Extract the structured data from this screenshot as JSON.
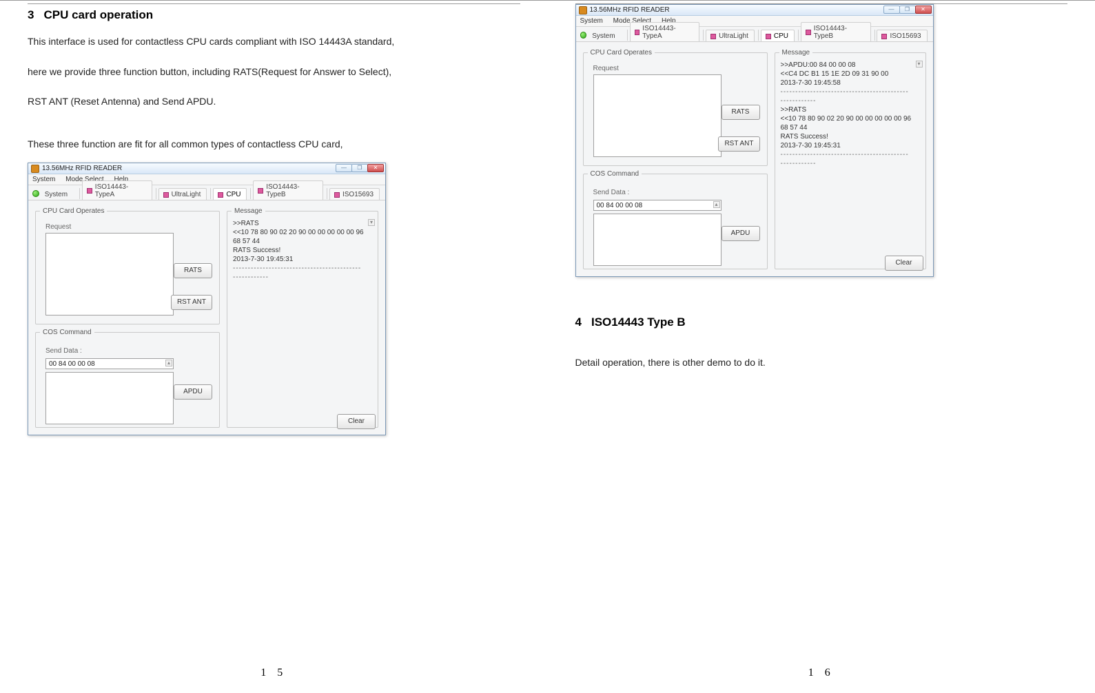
{
  "left": {
    "heading_num": "3",
    "heading_text": "CPU card operation",
    "para1": "This interface is used for contactless CPU cards compliant with ISO 14443A standard,",
    "para2": "here we provide three function button, including RATS(Request for Answer to Select),",
    "para3": "RST ANT (Reset Antenna) and Send APDU.",
    "para4": "These three function are fit for all common types of contactless CPU card,",
    "page_num": "1 5"
  },
  "right": {
    "heading_num": "4",
    "heading_text": "ISO14443 Type B",
    "para1": "Detail operation, there is other demo to do it.",
    "page_num": "1 6"
  },
  "app": {
    "title": "13.56MHz RFID READER",
    "menu": {
      "m1": "System",
      "m2": "Mode Select",
      "m3": "Help"
    },
    "tabs": {
      "system": "System",
      "typea": "ISO14443-TypeA",
      "ul": "UltraLight",
      "cpu": "CPU",
      "typeb": "ISO14443-TypeB",
      "iso15693": "ISO15693"
    },
    "groups": {
      "cpu_legend": "CPU Card Operates",
      "request_label": "Request",
      "rats_btn": "RATS",
      "rst_btn": "RST ANT",
      "cos_legend": "COS Command",
      "send_label": "Send Data :",
      "send_value": "00 84 00 00 08",
      "apdu_btn": "APDU",
      "msg_legend": "Message",
      "clear_btn": "Clear"
    },
    "win": {
      "min": "—",
      "max": "❐",
      "close": "✕"
    }
  },
  "msg1": {
    "l1": ">>RATS",
    "l2": "<<10 78 80 90 02 20 90 00 00 00 00 00 96 68 57 44",
    "l3": "RATS Success!",
    "l4": "2013-7-30  19:45:31",
    "sep": "-------------------------------------------------------"
  },
  "msg2": {
    "a1": ">>APDU:00 84 00 00 08",
    "a2": "<<C4 DC B1 15 1E 2D 09 31 90 00",
    "a3": "2013-7-30  19:45:58",
    "sep1": "-------------------------------------------------------",
    "b1": ">>RATS",
    "b2": "<<10 78 80 90 02 20 90 00 00 00 00 00 96 68 57 44",
    "b3": "RATS Success!",
    "b4": "2013-7-30  19:45:31",
    "sep2": "-------------------------------------------------------"
  }
}
